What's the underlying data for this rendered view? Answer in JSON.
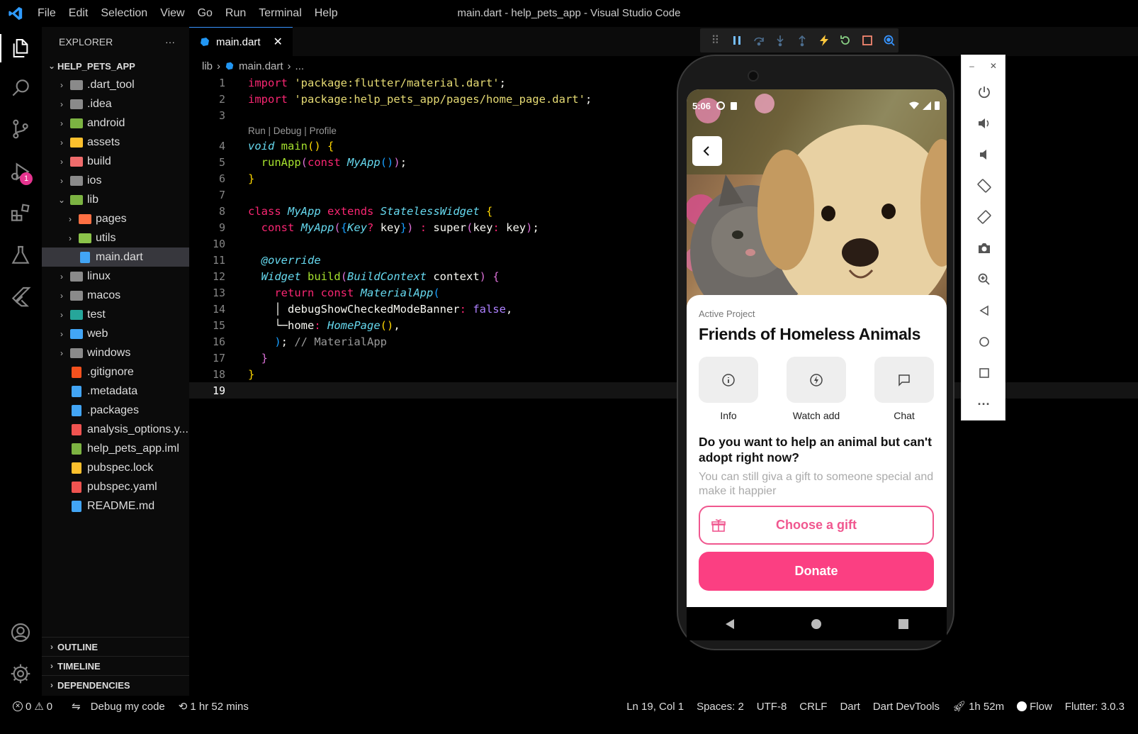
{
  "window_title": "main.dart - help_pets_app - Visual Studio Code",
  "menu": [
    "File",
    "Edit",
    "Selection",
    "View",
    "Go",
    "Run",
    "Terminal",
    "Help"
  ],
  "activity": {
    "debug_badge": "1"
  },
  "explorer": {
    "header": "EXPLORER",
    "more": "···",
    "root": "HELP_PETS_APP",
    "items": [
      {
        "label": ".dart_tool",
        "type": "folder",
        "depth": 0,
        "color": "#8a8a8a"
      },
      {
        "label": ".idea",
        "type": "folder",
        "depth": 0,
        "color": "#8a8a8a"
      },
      {
        "label": "android",
        "type": "folder",
        "depth": 0,
        "color": "#7cb342"
      },
      {
        "label": "assets",
        "type": "folder",
        "depth": 0,
        "color": "#fbc02d"
      },
      {
        "label": "build",
        "type": "folder",
        "depth": 0,
        "color": "#ef6c6c"
      },
      {
        "label": "ios",
        "type": "folder",
        "depth": 0,
        "color": "#8a8a8a"
      },
      {
        "label": "lib",
        "type": "folder-open",
        "depth": 0,
        "color": "#7cb342"
      },
      {
        "label": "pages",
        "type": "folder",
        "depth": 1,
        "color": "#ff7043"
      },
      {
        "label": "utils",
        "type": "folder",
        "depth": 1,
        "color": "#8bc34a"
      },
      {
        "label": "main.dart",
        "type": "file",
        "depth": 1,
        "color": "#42a5f5"
      },
      {
        "label": "linux",
        "type": "folder",
        "depth": 0,
        "color": "#8a8a8a"
      },
      {
        "label": "macos",
        "type": "folder",
        "depth": 0,
        "color": "#8a8a8a"
      },
      {
        "label": "test",
        "type": "folder",
        "depth": 0,
        "color": "#26a69a"
      },
      {
        "label": "web",
        "type": "folder",
        "depth": 0,
        "color": "#42a5f5"
      },
      {
        "label": "windows",
        "type": "folder",
        "depth": 0,
        "color": "#8a8a8a"
      },
      {
        "label": ".gitignore",
        "type": "file",
        "depth": 0,
        "color": "#f4511e"
      },
      {
        "label": ".metadata",
        "type": "file",
        "depth": 0,
        "color": "#42a5f5"
      },
      {
        "label": ".packages",
        "type": "file",
        "depth": 0,
        "color": "#42a5f5"
      },
      {
        "label": "analysis_options.y...",
        "type": "file",
        "depth": 0,
        "color": "#ef5350"
      },
      {
        "label": "help_pets_app.iml",
        "type": "file",
        "depth": 0,
        "color": "#7cb342"
      },
      {
        "label": "pubspec.lock",
        "type": "file",
        "depth": 0,
        "color": "#fbc02d"
      },
      {
        "label": "pubspec.yaml",
        "type": "file",
        "depth": 0,
        "color": "#ef5350"
      },
      {
        "label": "README.md",
        "type": "file",
        "depth": 0,
        "color": "#42a5f5"
      }
    ],
    "selected_index": 9,
    "bottom": [
      "OUTLINE",
      "TIMELINE",
      "DEPENDENCIES"
    ]
  },
  "editor": {
    "tab": "main.dart",
    "close": "✕",
    "breadcrumb": [
      "lib",
      "main.dart",
      "..."
    ],
    "codelens": "Run | Debug | Profile",
    "lines": [
      {
        "n": "1",
        "tokens": [
          [
            "kw",
            "import"
          ],
          [
            "txt",
            " "
          ],
          [
            "str",
            "'package:flutter/material.dart'"
          ],
          [
            "txt",
            ";"
          ]
        ]
      },
      {
        "n": "2",
        "tokens": [
          [
            "kw",
            "import"
          ],
          [
            "txt",
            " "
          ],
          [
            "str",
            "'package:help_pets_app/pages/home_page.dart'"
          ],
          [
            "txt",
            ";"
          ]
        ]
      },
      {
        "n": "3",
        "tokens": []
      },
      {
        "n": "4",
        "tokens": [
          [
            "it",
            "void"
          ],
          [
            "txt",
            " "
          ],
          [
            "fn",
            "main"
          ],
          [
            "par",
            "()"
          ],
          [
            "txt",
            " "
          ],
          [
            "par",
            "{"
          ]
        ]
      },
      {
        "n": "5",
        "tokens": [
          [
            "txt",
            "  "
          ],
          [
            "fn",
            "runApp"
          ],
          [
            "par2",
            "("
          ],
          [
            "kw",
            "const"
          ],
          [
            "txt",
            " "
          ],
          [
            "cls",
            "MyApp"
          ],
          [
            "par3",
            "()"
          ],
          [
            "par2",
            ")"
          ],
          [
            "txt",
            ";"
          ]
        ]
      },
      {
        "n": "6",
        "tokens": [
          [
            "par",
            "}"
          ]
        ]
      },
      {
        "n": "7",
        "tokens": []
      },
      {
        "n": "8",
        "tokens": [
          [
            "kw",
            "class"
          ],
          [
            "txt",
            " "
          ],
          [
            "cls",
            "MyApp"
          ],
          [
            "txt",
            " "
          ],
          [
            "kw",
            "extends"
          ],
          [
            "txt",
            " "
          ],
          [
            "cls",
            "StatelessWidget"
          ],
          [
            "txt",
            " "
          ],
          [
            "par",
            "{"
          ]
        ]
      },
      {
        "n": "9",
        "tokens": [
          [
            "txt",
            "  "
          ],
          [
            "kw",
            "const"
          ],
          [
            "txt",
            " "
          ],
          [
            "cls",
            "MyApp"
          ],
          [
            "par2",
            "("
          ],
          [
            "par3",
            "{"
          ],
          [
            "cls",
            "Key"
          ],
          [
            "kw",
            "?"
          ],
          [
            "txt",
            " key"
          ],
          [
            "par3",
            "}"
          ],
          [
            "par2",
            ")"
          ],
          [
            "txt",
            " "
          ],
          [
            "kw",
            ":"
          ],
          [
            "txt",
            " super"
          ],
          [
            "par2",
            "("
          ],
          [
            "txt",
            "key"
          ],
          [
            "kw",
            ":"
          ],
          [
            "txt",
            " key"
          ],
          [
            "par2",
            ")"
          ],
          [
            "txt",
            ";"
          ]
        ]
      },
      {
        "n": "10",
        "tokens": []
      },
      {
        "n": "11",
        "tokens": [
          [
            "txt",
            "  "
          ],
          [
            "it",
            "@override"
          ]
        ]
      },
      {
        "n": "12",
        "tokens": [
          [
            "txt",
            "  "
          ],
          [
            "it",
            "Widget"
          ],
          [
            "txt",
            " "
          ],
          [
            "fn",
            "build"
          ],
          [
            "par2",
            "("
          ],
          [
            "cls",
            "BuildContext"
          ],
          [
            "txt",
            " context"
          ],
          [
            "par2",
            ")"
          ],
          [
            "txt",
            " "
          ],
          [
            "par2",
            "{"
          ]
        ]
      },
      {
        "n": "13",
        "tokens": [
          [
            "txt",
            "    "
          ],
          [
            "kw",
            "return"
          ],
          [
            "txt",
            " "
          ],
          [
            "kw",
            "const"
          ],
          [
            "txt",
            " "
          ],
          [
            "cls",
            "MaterialApp"
          ],
          [
            "par3",
            "("
          ]
        ]
      },
      {
        "n": "14",
        "tokens": [
          [
            "txt",
            "    │ debugShowCheckedModeBanner"
          ],
          [
            "kw",
            ":"
          ],
          [
            "txt",
            " "
          ],
          [
            "bool",
            "false"
          ],
          [
            "txt",
            ","
          ]
        ]
      },
      {
        "n": "15",
        "tokens": [
          [
            "txt",
            "    └─home"
          ],
          [
            "kw",
            ":"
          ],
          [
            "txt",
            " "
          ],
          [
            "cls",
            "HomePage"
          ],
          [
            "par",
            "()"
          ],
          [
            "txt",
            ","
          ]
        ]
      },
      {
        "n": "16",
        "tokens": [
          [
            "txt",
            "    "
          ],
          [
            "par3",
            ")"
          ],
          [
            "txt",
            "; "
          ],
          [
            "cm",
            "// MaterialApp"
          ]
        ]
      },
      {
        "n": "17",
        "tokens": [
          [
            "txt",
            "  "
          ],
          [
            "par2",
            "}"
          ]
        ]
      },
      {
        "n": "18",
        "tokens": [
          [
            "par",
            "}"
          ]
        ]
      },
      {
        "n": "19",
        "tokens": []
      }
    ],
    "cursor_line": "19"
  },
  "phone": {
    "time": "5:06",
    "card_label": "Active Project",
    "title": "Friends of Homeless Animals",
    "actions": [
      "Info",
      "Watch add",
      "Chat"
    ],
    "question": "Do you want to help an animal but can't adopt right now?",
    "subtitle": "You can still giva a gift to someone special and make it happier",
    "gift_button": "Choose a gift",
    "donate_button": "Donate"
  },
  "emulator_toolbar": {
    "minimize": "–",
    "close": "✕"
  },
  "statusbar": {
    "errors": "0",
    "warnings": "0",
    "debug": "Debug my code",
    "timer": "1 hr 52 mins",
    "position": "Ln 19, Col 1",
    "spaces": "Spaces: 2",
    "encoding": "UTF-8",
    "eol": "CRLF",
    "language": "Dart",
    "devtools": "Dart DevTools",
    "time_tracked": "1h 52m",
    "flow": "Flow",
    "flutter": "Flutter: 3.0.3"
  },
  "colors": {
    "accent_pink": "#fb3f82",
    "outline_pink": "#f0578f",
    "vscode_blue": "#3794ff"
  }
}
